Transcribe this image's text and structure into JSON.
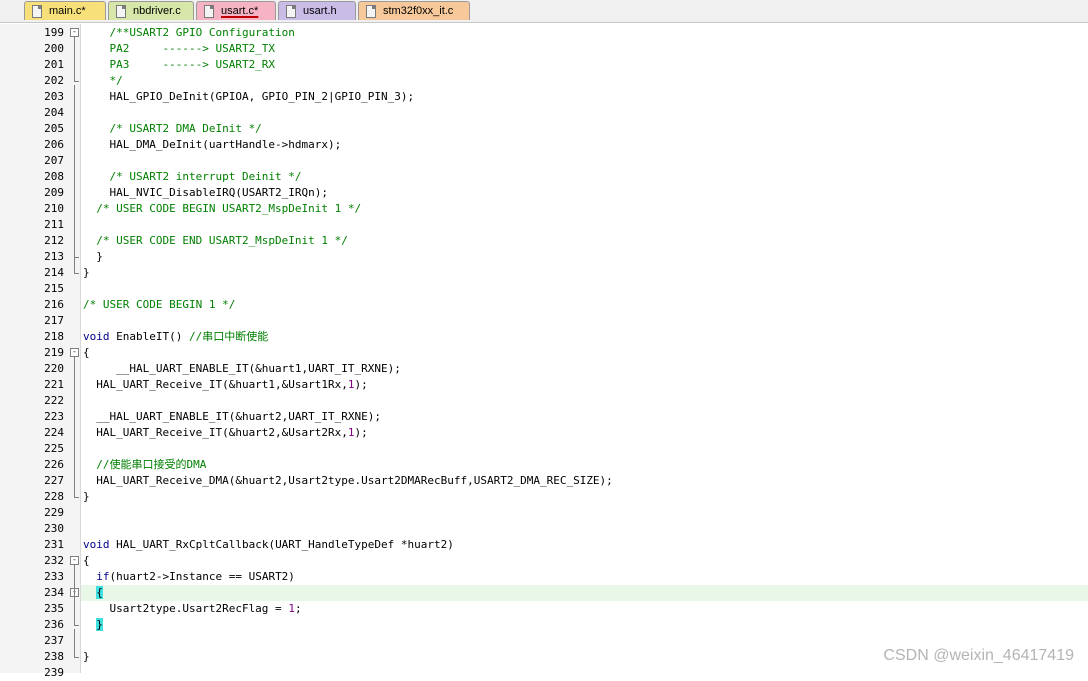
{
  "tabs": [
    {
      "label": "main.c*",
      "color": "#f7e07a",
      "active": false
    },
    {
      "label": "nbdriver.c",
      "color": "#d6e7a9",
      "active": false
    },
    {
      "label": "usart.c*",
      "color": "#f5b3c4",
      "active": true
    },
    {
      "label": "usart.h",
      "color": "#c9bde8",
      "active": false
    },
    {
      "label": "stm32f0xx_it.c",
      "color": "#f7c99a",
      "active": false
    }
  ],
  "lines": [
    {
      "num": "199",
      "text": "    /**USART2 GPIO Configuration",
      "cls": "c"
    },
    {
      "num": "200",
      "text": "    PA2     ------> USART2_TX",
      "cls": "c"
    },
    {
      "num": "201",
      "text": "    PA3     ------> USART2_RX",
      "cls": "c"
    },
    {
      "num": "202",
      "text": "    */",
      "cls": "c"
    },
    {
      "num": "203",
      "text": "    HAL_GPIO_DeInit(GPIOA, GPIO_PIN_2|GPIO_PIN_3);",
      "cls": "o"
    },
    {
      "num": "204",
      "text": "",
      "cls": "o"
    },
    {
      "num": "205",
      "text": "    /* USART2 DMA DeInit */",
      "cls": "c"
    },
    {
      "num": "206",
      "text": "    HAL_DMA_DeInit(uartHandle->hdmarx);",
      "cls": "o"
    },
    {
      "num": "207",
      "text": "",
      "cls": "o"
    },
    {
      "num": "208",
      "text": "    /* USART2 interrupt Deinit */",
      "cls": "c"
    },
    {
      "num": "209",
      "text": "    HAL_NVIC_DisableIRQ(USART2_IRQn);",
      "cls": "o"
    },
    {
      "num": "210",
      "text": "  /* USER CODE BEGIN USART2_MspDeInit 1 */",
      "cls": "c"
    },
    {
      "num": "211",
      "text": "",
      "cls": "o"
    },
    {
      "num": "212",
      "text": "  /* USER CODE END USART2_MspDeInit 1 */",
      "cls": "c"
    },
    {
      "num": "213",
      "text": "  }",
      "cls": "o"
    },
    {
      "num": "214",
      "text": "}",
      "cls": "o"
    },
    {
      "num": "215",
      "text": "",
      "cls": "o"
    },
    {
      "num": "216",
      "text": "/* USER CODE BEGIN 1 */",
      "cls": "c"
    },
    {
      "num": "217",
      "text": "",
      "cls": "o"
    },
    {
      "num": "218",
      "text": "",
      "cls": "o",
      "parts": [
        {
          "t": "void",
          "c": "k"
        },
        {
          "t": " EnableIT() ",
          "c": "o"
        },
        {
          "t": "//串口中断使能",
          "c": "c"
        }
      ]
    },
    {
      "num": "219",
      "text": "{",
      "cls": "o"
    },
    {
      "num": "220",
      "text": "     __HAL_UART_ENABLE_IT(&huart1,UART_IT_RXNE);",
      "cls": "o"
    },
    {
      "num": "221",
      "text": "",
      "cls": "o",
      "parts": [
        {
          "t": "  HAL_UART_Receive_IT(&huart1,&Usart1Rx,",
          "c": "o"
        },
        {
          "t": "1",
          "c": "n"
        },
        {
          "t": ");",
          "c": "o"
        }
      ]
    },
    {
      "num": "222",
      "text": "",
      "cls": "o"
    },
    {
      "num": "223",
      "text": "  __HAL_UART_ENABLE_IT(&huart2,UART_IT_RXNE);",
      "cls": "o"
    },
    {
      "num": "224",
      "text": "",
      "cls": "o",
      "parts": [
        {
          "t": "  HAL_UART_Receive_IT(&huart2,&Usart2Rx,",
          "c": "o"
        },
        {
          "t": "1",
          "c": "n"
        },
        {
          "t": ");",
          "c": "o"
        }
      ]
    },
    {
      "num": "225",
      "text": "",
      "cls": "o"
    },
    {
      "num": "226",
      "text": "  //使能串口接受的DMA",
      "cls": "c"
    },
    {
      "num": "227",
      "text": "  HAL_UART_Receive_DMA(&huart2,Usart2type.Usart2DMARecBuff,USART2_DMA_REC_SIZE);",
      "cls": "o"
    },
    {
      "num": "228",
      "text": "}",
      "cls": "o"
    },
    {
      "num": "229",
      "text": "",
      "cls": "o"
    },
    {
      "num": "230",
      "text": "",
      "cls": "o"
    },
    {
      "num": "231",
      "text": "",
      "cls": "o",
      "parts": [
        {
          "t": "void",
          "c": "k"
        },
        {
          "t": " HAL_UART_RxCpltCallback(UART_HandleTypeDef *huart2)",
          "c": "o"
        }
      ]
    },
    {
      "num": "232",
      "text": "{",
      "cls": "o"
    },
    {
      "num": "233",
      "text": "",
      "cls": "o",
      "parts": [
        {
          "t": "  ",
          "c": "o"
        },
        {
          "t": "if",
          "c": "k"
        },
        {
          "t": "(huart2->Instance == USART2)",
          "c": "o"
        }
      ]
    },
    {
      "num": "234",
      "text": "",
      "cls": "o",
      "highlight": true,
      "parts": [
        {
          "t": "  ",
          "c": "o"
        },
        {
          "t": "{",
          "c": "o",
          "brace": true
        }
      ]
    },
    {
      "num": "235",
      "text": "",
      "cls": "o",
      "parts": [
        {
          "t": "    Usart2type.Usart2RecFlag = ",
          "c": "o"
        },
        {
          "t": "1",
          "c": "n"
        },
        {
          "t": ";",
          "c": "o"
        }
      ]
    },
    {
      "num": "236",
      "text": "",
      "cls": "o",
      "parts": [
        {
          "t": "  ",
          "c": "o"
        },
        {
          "t": "}",
          "c": "o",
          "brace": true
        }
      ]
    },
    {
      "num": "237",
      "text": "",
      "cls": "o"
    },
    {
      "num": "238",
      "text": "}",
      "cls": "o"
    },
    {
      "num": "239",
      "text": "",
      "cls": "o"
    }
  ],
  "fold_boxes": {
    "199": "-",
    "219": "-",
    "232": "-",
    "234": "-"
  },
  "watermark": "CSDN @weixin_46417419"
}
